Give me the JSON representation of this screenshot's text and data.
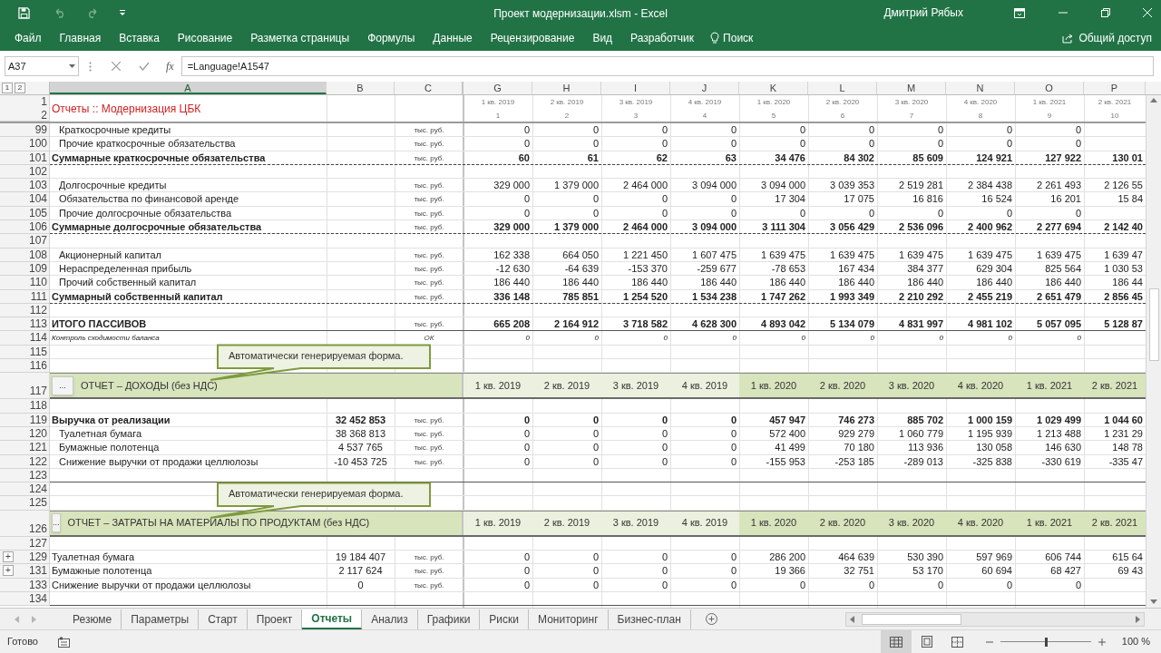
{
  "window": {
    "title": "Проект модернизации.xlsm - Excel",
    "user": "Дмитрий Рябых"
  },
  "ribbon": {
    "tabs": [
      "Файл",
      "Главная",
      "Вставка",
      "Рисование",
      "Разметка страницы",
      "Формулы",
      "Данные",
      "Рецензирование",
      "Вид",
      "Разработчик"
    ],
    "search": "Поиск",
    "share": "Общий доступ"
  },
  "formula_bar": {
    "name_box": "A37",
    "function_label": "fx",
    "formula": "=Language!A1547"
  },
  "outline_levels": [
    "1",
    "2"
  ],
  "columns": [
    {
      "letter": "A",
      "selected": true
    },
    {
      "letter": "B",
      "selected": false
    },
    {
      "letter": "C",
      "selected": false
    },
    {
      "letter": "G",
      "selected": false
    },
    {
      "letter": "H",
      "selected": false
    },
    {
      "letter": "I",
      "selected": false
    },
    {
      "letter": "J",
      "selected": false
    },
    {
      "letter": "K",
      "selected": false
    },
    {
      "letter": "L",
      "selected": false
    },
    {
      "letter": "M",
      "selected": false
    },
    {
      "letter": "N",
      "selected": false
    },
    {
      "letter": "O",
      "selected": false
    },
    {
      "letter": "P",
      "selected": false
    }
  ],
  "header": {
    "rows": [
      "1",
      "2"
    ],
    "title": "Отчеты :: Модернизация ЦБК",
    "periods": [
      {
        "label": "1 кв. 2019",
        "index": "1"
      },
      {
        "label": "2 кв. 2019",
        "index": "2"
      },
      {
        "label": "3 кв. 2019",
        "index": "3"
      },
      {
        "label": "4 кв. 2019",
        "index": "4"
      },
      {
        "label": "1 кв. 2020",
        "index": "5"
      },
      {
        "label": "2 кв. 2020",
        "index": "6"
      },
      {
        "label": "3 кв. 2020",
        "index": "7"
      },
      {
        "label": "4 кв. 2020",
        "index": "8"
      },
      {
        "label": "1 кв. 2021",
        "index": "9"
      },
      {
        "label": "2 кв. 2021",
        "index": "10"
      }
    ]
  },
  "rows": [
    {
      "number": "99",
      "kind": "item",
      "label": "Краткосрочные кредиты",
      "unit": "тыс. руб.",
      "values": [
        "0",
        "0",
        "0",
        "0",
        "0",
        "0",
        "0",
        "0",
        "0"
      ]
    },
    {
      "number": "100",
      "kind": "item",
      "label": "Прочие краткосрочные обязательства",
      "unit": "тыс. руб.",
      "values": [
        "0",
        "0",
        "0",
        "0",
        "0",
        "0",
        "0",
        "0",
        "0"
      ]
    },
    {
      "number": "101",
      "kind": "total",
      "label": "Суммарные краткосрочные обязательства",
      "unit": "тыс. руб.",
      "rule_below": true,
      "dotted": true,
      "values": [
        "60",
        "61",
        "62",
        "63",
        "34 476",
        "84 302",
        "85 609",
        "124 921",
        "127 922",
        "130 01"
      ]
    },
    {
      "number": "102",
      "kind": "blank"
    },
    {
      "number": "103",
      "kind": "item",
      "label": "Долгосрочные кредиты",
      "unit": "тыс. руб.",
      "values": [
        "329 000",
        "1 379 000",
        "2 464 000",
        "3 094 000",
        "3 094 000",
        "3 039 353",
        "2 519 281",
        "2 384 438",
        "2 261 493",
        "2 126 55"
      ]
    },
    {
      "number": "104",
      "kind": "item",
      "label": "Обязательства по финансовой аренде",
      "unit": "тыс. руб.",
      "values": [
        "0",
        "0",
        "0",
        "0",
        "17 304",
        "17 075",
        "16 816",
        "16 524",
        "16 201",
        "15 84"
      ]
    },
    {
      "number": "105",
      "kind": "item",
      "label": "Прочие долгосрочные обязательства",
      "unit": "тыс. руб.",
      "values": [
        "0",
        "0",
        "0",
        "0",
        "0",
        "0",
        "0",
        "0",
        "0"
      ]
    },
    {
      "number": "106",
      "kind": "total",
      "label": "Суммарные долгосрочные обязательства",
      "unit": "тыс. руб.",
      "rule_below": true,
      "dotted": true,
      "values": [
        "329 000",
        "1 379 000",
        "2 464 000",
        "3 094 000",
        "3 111 304",
        "3 056 429",
        "2 536 096",
        "2 400 962",
        "2 277 694",
        "2 142 40"
      ]
    },
    {
      "number": "107",
      "kind": "blank"
    },
    {
      "number": "108",
      "kind": "item",
      "label": "Акционерный капитал",
      "unit": "тыс. руб.",
      "values": [
        "162 338",
        "664 050",
        "1 221 450",
        "1 607 475",
        "1 639 475",
        "1 639 475",
        "1 639 475",
        "1 639 475",
        "1 639 475",
        "1 639 47"
      ]
    },
    {
      "number": "109",
      "kind": "item",
      "label": "Нераспределенная прибыль",
      "unit": "тыс. руб.",
      "values": [
        "-12 630",
        "-64 639",
        "-153 370",
        "-259 677",
        "-78 653",
        "167 434",
        "384 377",
        "629 304",
        "825 564",
        "1 030 53"
      ]
    },
    {
      "number": "110",
      "kind": "item",
      "label": "Прочий собственный капитал",
      "unit": "тыс. руб.",
      "values": [
        "186 440",
        "186 440",
        "186 440",
        "186 440",
        "186 440",
        "186 440",
        "186 440",
        "186 440",
        "186 440",
        "186 44"
      ]
    },
    {
      "number": "111",
      "kind": "total",
      "label": "Суммарный собственный капитал",
      "unit": "тыс. руб.",
      "rule_below": true,
      "dotted": true,
      "values": [
        "336 148",
        "785 851",
        "1 254 520",
        "1 534 238",
        "1 747 262",
        "1 993 349",
        "2 210 292",
        "2 455 219",
        "2 651 479",
        "2 856 45"
      ]
    },
    {
      "number": "112",
      "kind": "blank"
    },
    {
      "number": "113",
      "kind": "total",
      "label": "ИТОГО ПАССИВОВ",
      "unit": "тыс. руб.",
      "rule_below": true,
      "dotted": false,
      "values": [
        "665 208",
        "2 164 912",
        "3 718 582",
        "4 628 300",
        "4 893 042",
        "5 134 079",
        "4 831 997",
        "4 981 102",
        "5 057 095",
        "5 128 87"
      ]
    },
    {
      "number": "114",
      "kind": "check",
      "label": "Контроль сходимости баланса",
      "unit": "ОК",
      "values": [
        "0",
        "0",
        "0",
        "0",
        "0",
        "0",
        "0",
        "0",
        "0"
      ]
    },
    {
      "number": "115",
      "kind": "blank"
    },
    {
      "number": "116",
      "kind": "blank"
    },
    {
      "number": "117",
      "kind": "section",
      "button": "...",
      "label": "ОТЧЕТ – ДОХОДЫ (без НДС)",
      "callout": "Автоматически генерируемая форма.",
      "periods": [
        {
          "label": "1 кв. 2019",
          "highlighted": false
        },
        {
          "label": "2 кв. 2019",
          "highlighted": false
        },
        {
          "label": "3 кв. 2019",
          "highlighted": false
        },
        {
          "label": "4 кв. 2019",
          "highlighted": false
        },
        {
          "label": "1 кв. 2020",
          "highlighted": true
        },
        {
          "label": "2 кв. 2020",
          "highlighted": true
        },
        {
          "label": "3 кв. 2020",
          "highlighted": true
        },
        {
          "label": "4 кв. 2020",
          "highlighted": true
        },
        {
          "label": "1 кв. 2021",
          "highlighted": true
        },
        {
          "label": "2 кв. 2021",
          "highlighted": true
        }
      ]
    },
    {
      "number": "118",
      "kind": "blank"
    },
    {
      "number": "119",
      "kind": "total",
      "label": "Выручка от реализации",
      "amount": "32 452 853",
      "unit": "тыс. руб.",
      "values": [
        "0",
        "0",
        "0",
        "0",
        "457 947",
        "746 273",
        "885 702",
        "1 000 159",
        "1 029 499",
        "1 044 60"
      ]
    },
    {
      "number": "120",
      "kind": "item",
      "label": "Туалетная бумага",
      "amount": "38 368 813",
      "unit": "тыс. руб.",
      "values": [
        "0",
        "0",
        "0",
        "0",
        "572 400",
        "929 279",
        "1 060 779",
        "1 195 939",
        "1 213 488",
        "1 231 29"
      ]
    },
    {
      "number": "121",
      "kind": "item",
      "label": "Бумажные полотенца",
      "amount": "4 537 765",
      "unit": "тыс. руб.",
      "values": [
        "0",
        "0",
        "0",
        "0",
        "41 499",
        "70 180",
        "113 936",
        "130 058",
        "146 630",
        "148 78"
      ]
    },
    {
      "number": "122",
      "kind": "item",
      "label": "Снижение выручки от продажи целлюлозы",
      "amount": "-10 453 725",
      "unit": "тыс. руб.",
      "values": [
        "0",
        "0",
        "0",
        "0",
        "-155 953",
        "-253 185",
        "-289 013",
        "-325 838",
        "-330 619",
        "-335 47"
      ]
    },
    {
      "number": "123",
      "kind": "blank",
      "rule_below": true,
      "dotted": false
    },
    {
      "number": "124",
      "kind": "blank"
    },
    {
      "number": "125",
      "kind": "blank"
    },
    {
      "number": "126",
      "kind": "section",
      "button": "...",
      "label": "ОТЧЕТ – ЗАТРАТЫ НА МАТЕРИАЛЫ ПО ПРОДУКТАМ (без НДС)",
      "callout": "Автоматически генерируемая форма.",
      "periods": [
        {
          "label": "1 кв. 2019",
          "highlighted": false
        },
        {
          "label": "2 кв. 2019",
          "highlighted": false
        },
        {
          "label": "3 кв. 2019",
          "highlighted": false
        },
        {
          "label": "4 кв. 2019",
          "highlighted": false
        },
        {
          "label": "1 кв. 2020",
          "highlighted": true
        },
        {
          "label": "2 кв. 2020",
          "highlighted": true
        },
        {
          "label": "3 кв. 2020",
          "highlighted": true
        },
        {
          "label": "4 кв. 2020",
          "highlighted": true
        },
        {
          "label": "1 кв. 2021",
          "highlighted": true
        },
        {
          "label": "2 кв. 2021",
          "highlighted": true
        }
      ]
    },
    {
      "number": "127",
      "kind": "blank"
    },
    {
      "number": "129",
      "kind": "plain",
      "outline_button": "+",
      "label": "Туалетная бумага",
      "amount": "19 184 407",
      "unit": "тыс. руб.",
      "values": [
        "0",
        "0",
        "0",
        "0",
        "286 200",
        "464 639",
        "530 390",
        "597 969",
        "606 744",
        "615 64"
      ]
    },
    {
      "number": "131",
      "kind": "plain",
      "outline_button": "+",
      "label": "Бумажные полотенца",
      "amount": "2 117 624",
      "unit": "тыс. руб.",
      "values": [
        "0",
        "0",
        "0",
        "0",
        "19 366",
        "32 751",
        "53 170",
        "60 694",
        "68 427",
        "69 43"
      ]
    },
    {
      "number": "133",
      "kind": "plain",
      "label": "Снижение выручки от продажи целлюлозы",
      "amount": "0",
      "unit": "тыс. руб.",
      "values": [
        "0",
        "0",
        "0",
        "0",
        "0",
        "0",
        "0",
        "0",
        "0"
      ]
    },
    {
      "number": "134",
      "rule_below": true,
      "dotted": false,
      "kind": "blank"
    }
  ],
  "sheet_tabs": [
    {
      "label": "Резюме",
      "selected": false
    },
    {
      "label": "Параметры",
      "selected": false
    },
    {
      "label": "Старт",
      "selected": false
    },
    {
      "label": "Проект",
      "selected": false
    },
    {
      "label": "Отчеты",
      "selected": true
    },
    {
      "label": "Анализ",
      "selected": false
    },
    {
      "label": "Графики",
      "selected": false
    },
    {
      "label": "Риски",
      "selected": false
    },
    {
      "label": "Мониторинг",
      "selected": false
    },
    {
      "label": "Бизнес-план",
      "selected": false
    }
  ],
  "status_bar": {
    "text": "Готово",
    "views": [
      {
        "kind": "normal",
        "selected": true
      },
      {
        "kind": "page_layout",
        "selected": false
      },
      {
        "kind": "page_break",
        "selected": false
      }
    ],
    "zoom": {
      "level": 0.5,
      "reading": "100 %"
    }
  }
}
